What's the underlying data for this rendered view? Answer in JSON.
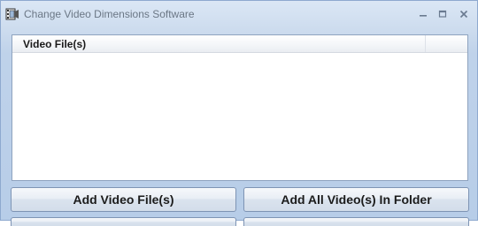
{
  "window": {
    "title": "Change Video Dimensions Software",
    "app_icon": "film-app-icon",
    "controls": {
      "minimize_icon": "minimize-icon",
      "maximize_icon": "maximize-icon",
      "close_icon": "close-icon"
    }
  },
  "file_list": {
    "columns": [
      "Video File(s)"
    ],
    "rows": []
  },
  "buttons": {
    "add_files_label": "Add Video File(s)",
    "add_folder_label": "Add All Video(s) In Folder"
  },
  "colors": {
    "window_bg": "#c5d7ec",
    "list_border": "#8ea3bf",
    "button_border": "#7e94b4"
  }
}
